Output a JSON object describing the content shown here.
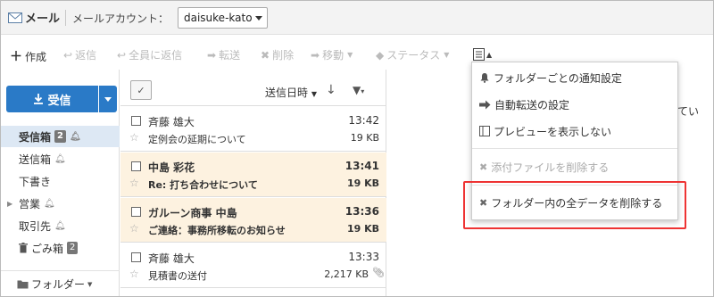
{
  "header": {
    "app_title": "メール",
    "account_label": "メールアカウント：",
    "account_value": "daisuke-kato"
  },
  "toolbar": {
    "create": "作成",
    "reply": "返信",
    "reply_all": "全員に返信",
    "forward": "転送",
    "delete": "削除",
    "move": "移動",
    "status": "ステータス"
  },
  "sidebar": {
    "receive_button": "受信",
    "folders": [
      {
        "label": "受信箱",
        "badge": "2",
        "bell": true
      },
      {
        "label": "送信箱",
        "badge": "",
        "bell": true
      },
      {
        "label": "下書き",
        "badge": "",
        "bell": false
      },
      {
        "label": "営業",
        "badge": "",
        "bell": true
      },
      {
        "label": "取引先",
        "badge": "",
        "bell": true
      },
      {
        "label": "ごみ箱",
        "badge": "2",
        "bell": false
      }
    ],
    "folder_menu": "フォルダー"
  },
  "list": {
    "sort_label": "送信日時",
    "rows": [
      {
        "from": "斉藤 雄大",
        "subject": "定例会の延期について",
        "time": "13:42",
        "size": "19 KB"
      },
      {
        "from": "中島 彩花",
        "subject": "Re: 打ち合わせについて",
        "time": "13:41",
        "size": "19 KB"
      },
      {
        "from": "ガルーン商事 中島",
        "subject": "ご連絡：事務所移転のお知らせ",
        "time": "13:36",
        "size": "19 KB"
      },
      {
        "from": "斉藤 雄大",
        "subject": "見積書の送付",
        "time": "13:33",
        "size": "2,217 KB"
      }
    ]
  },
  "preview": {
    "edge_text": "てい"
  },
  "menu": {
    "items": [
      {
        "label": "フォルダーごとの通知設定",
        "icon": "bell-icon"
      },
      {
        "label": "自動転送の設定",
        "icon": "arrow-right-icon"
      },
      {
        "label": "プレビューを表示しない",
        "icon": "preview-pane-icon"
      },
      {
        "label": "添付ファイルを削除する",
        "icon": "x-icon"
      },
      {
        "label": "フォルダー内の全データを削除する",
        "icon": "x-icon"
      }
    ]
  },
  "colors": {
    "accent": "#2a7ac7",
    "highlight_row": "#fdf2e0",
    "selected_folder": "#dde8f4",
    "callout": "#e33333"
  }
}
